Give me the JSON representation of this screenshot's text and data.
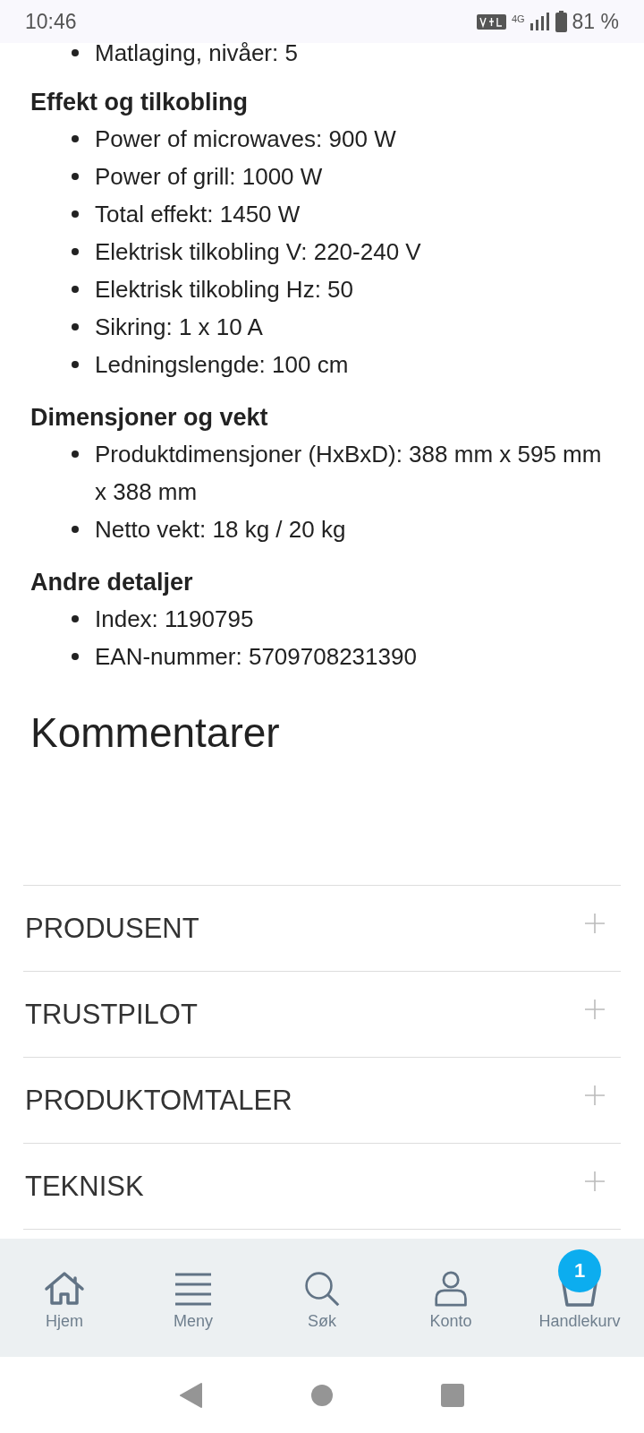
{
  "status_bar": {
    "time": "10:46",
    "network": "4G",
    "battery": "81 %"
  },
  "cut_item": "Matlaging, nivåer: 5",
  "sections": [
    {
      "title": "Effekt og tilkobling",
      "items": [
        "Power of microwaves: 900 W",
        "Power of grill: 1000 W",
        "Total effekt: 1450 W",
        "Elektrisk tilkobling V: 220-240 V",
        "Elektrisk tilkobling Hz: 50",
        "Sikring: 1 x 10 A",
        "Ledningslengde: 100 cm"
      ]
    },
    {
      "title": "Dimensjoner og vekt",
      "items": [
        "Produktdimensjoner (HxBxD): 388 mm x 595 mm x 388 mm",
        "Netto vekt: 18 kg / 20 kg"
      ]
    },
    {
      "title": "Andre detaljer",
      "items": [
        "Index: 1190795",
        "EAN-nummer: 5709708231390"
      ]
    }
  ],
  "comments_title": "Kommentarer",
  "accordion": [
    {
      "label": "PRODUSENT",
      "expanded": false
    },
    {
      "label": "TRUSTPILOT",
      "expanded": false
    },
    {
      "label": "PRODUKTOMTALER",
      "expanded": false
    },
    {
      "label": "TEKNISK",
      "expanded": false
    }
  ],
  "bottom_nav": [
    {
      "kind": "home",
      "label": "Hjem"
    },
    {
      "kind": "menu",
      "label": "Meny"
    },
    {
      "kind": "search",
      "label": "Søk"
    },
    {
      "kind": "account",
      "label": "Konto"
    },
    {
      "kind": "cart",
      "label": "Handlekurv",
      "badge": "1"
    }
  ]
}
